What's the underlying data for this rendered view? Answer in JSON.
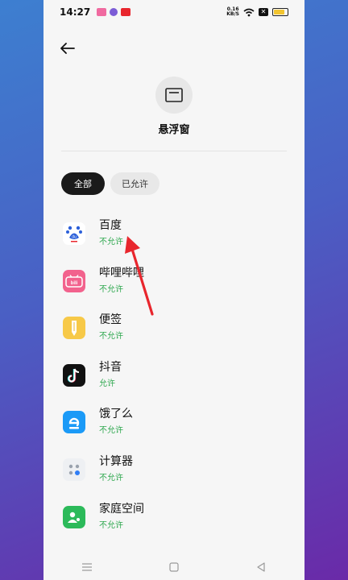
{
  "status_bar": {
    "time": "14:27",
    "net_speed_value": "0.16",
    "net_speed_unit": "KB/S"
  },
  "header": {
    "title": "悬浮窗"
  },
  "filters": {
    "all": "全部",
    "allowed": "已允许"
  },
  "apps": [
    {
      "name": "百度",
      "status": "不允许"
    },
    {
      "name": "哔哩哔哩",
      "status": "不允许"
    },
    {
      "name": "便签",
      "status": "不允许"
    },
    {
      "name": "抖音",
      "status": "允许"
    },
    {
      "name": "饿了么",
      "status": "不允许"
    },
    {
      "name": "计算器",
      "status": "不允许"
    },
    {
      "name": "家庭空间",
      "status": "不允许"
    }
  ],
  "colors": {
    "status_green": "#2fa84f",
    "arrow_red": "#e8262d",
    "active_filter": "#1a1a1a"
  }
}
